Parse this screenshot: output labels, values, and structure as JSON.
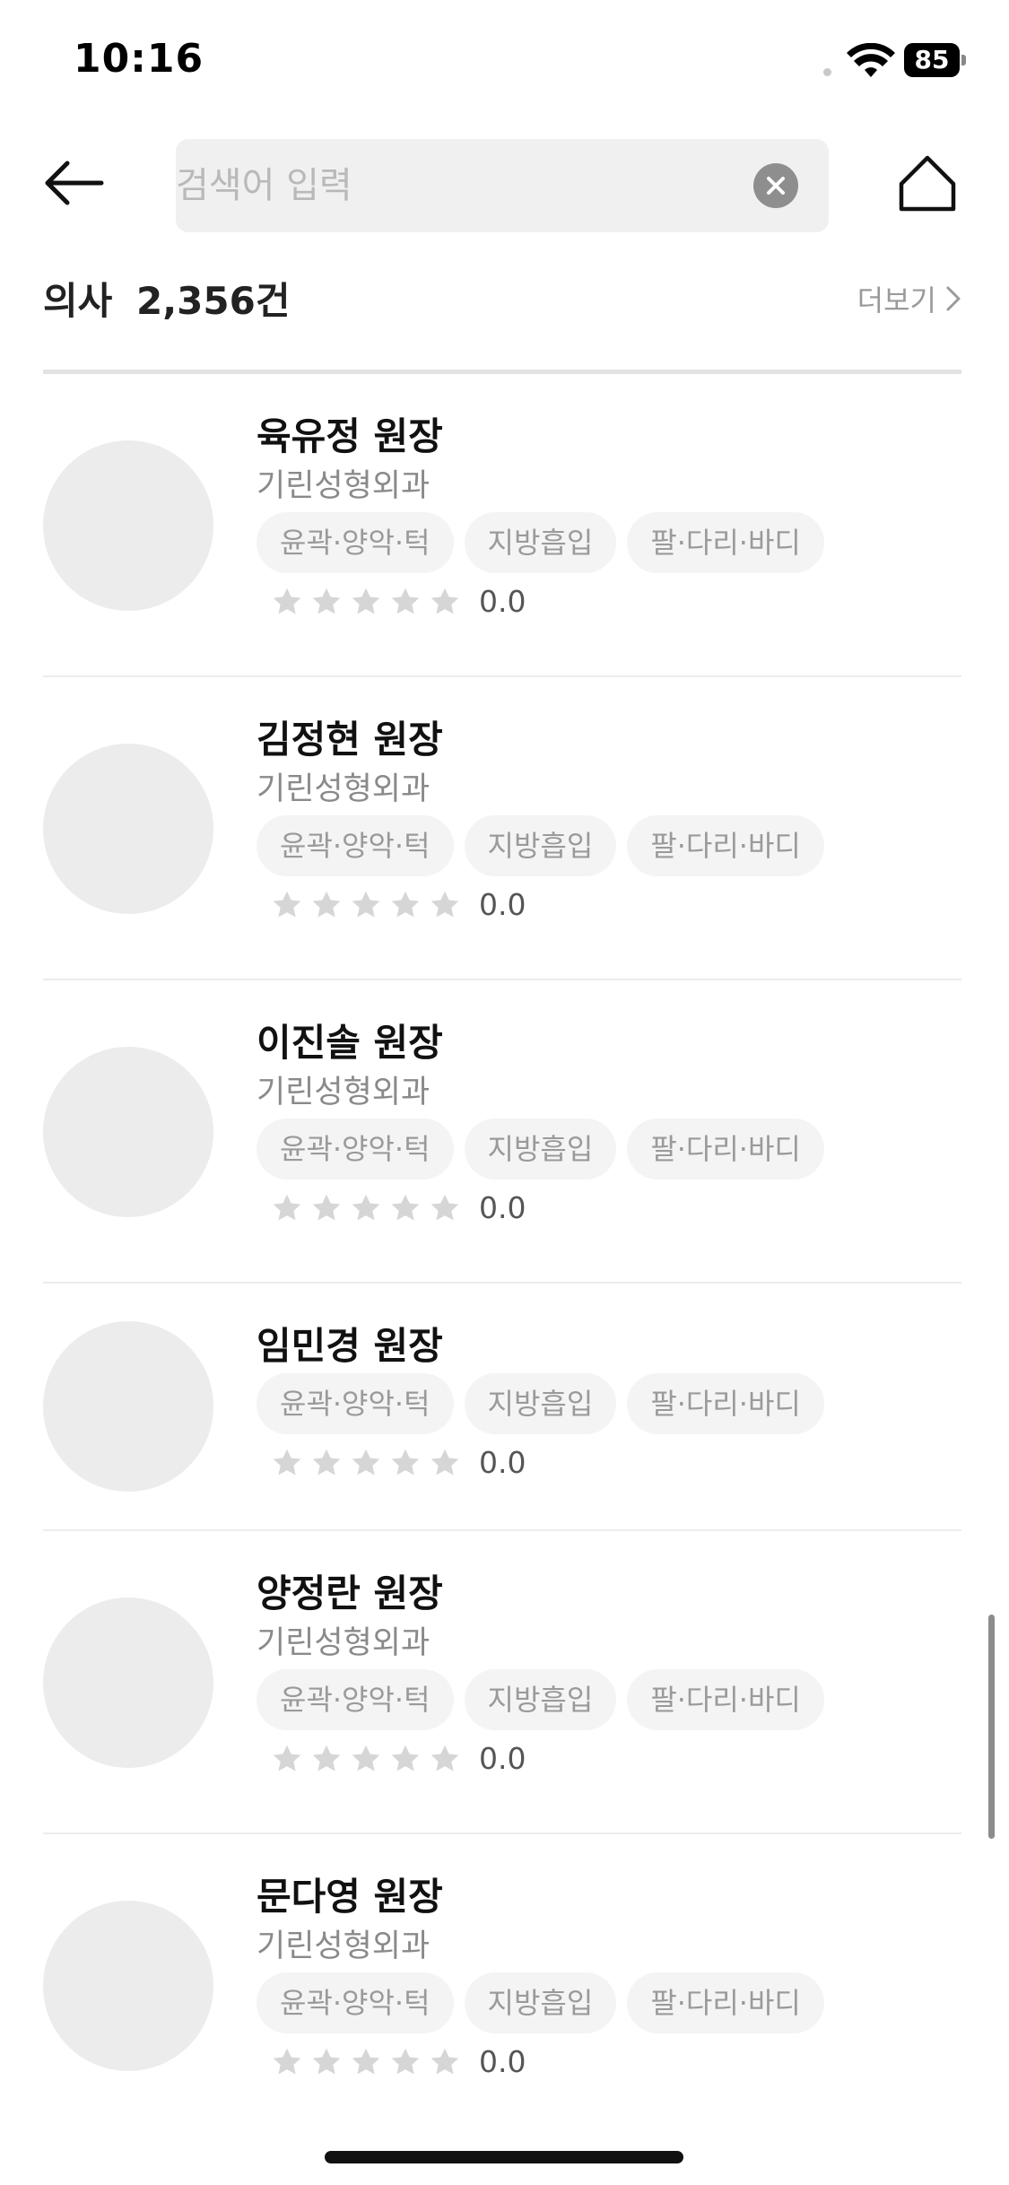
{
  "status_bar": {
    "time": "10:16",
    "battery": "85"
  },
  "search": {
    "placeholder": "검색어 입력"
  },
  "section": {
    "title": "의사",
    "count": "2,356건",
    "more_label": "더보기"
  },
  "doctors": [
    {
      "name": "육유정 원장",
      "hospital": "기린성형외과",
      "tags": [
        "윤곽·양악·턱",
        "지방흡입",
        "팔·다리·바디"
      ],
      "rating": "0.0",
      "star_count": 5,
      "filled_stars": 0
    },
    {
      "name": "김정현 원장",
      "hospital": "기린성형외과",
      "tags": [
        "윤곽·양악·턱",
        "지방흡입",
        "팔·다리·바디"
      ],
      "rating": "0.0",
      "star_count": 5,
      "filled_stars": 0
    },
    {
      "name": "이진솔 원장",
      "hospital": "기린성형외과",
      "tags": [
        "윤곽·양악·턱",
        "지방흡입",
        "팔·다리·바디"
      ],
      "rating": "0.0",
      "star_count": 5,
      "filled_stars": 0
    },
    {
      "name": "임민경 원장",
      "hospital": "",
      "tags": [
        "윤곽·양악·턱",
        "지방흡입",
        "팔·다리·바디"
      ],
      "rating": "0.0",
      "star_count": 5,
      "filled_stars": 0
    },
    {
      "name": "양정란 원장",
      "hospital": "기린성형외과",
      "tags": [
        "윤곽·양악·턱",
        "지방흡입",
        "팔·다리·바디"
      ],
      "rating": "0.0",
      "star_count": 5,
      "filled_stars": 0
    },
    {
      "name": "문다영 원장",
      "hospital": "기린성형외과",
      "tags": [
        "윤곽·양악·턱",
        "지방흡입",
        "팔·다리·바디"
      ],
      "rating": "0.0",
      "star_count": 5,
      "filled_stars": 0
    }
  ],
  "colors": {
    "star_empty": "#d6d6d6",
    "tag_bg": "#f4f4f4",
    "muted_text": "#8a8a8a"
  }
}
